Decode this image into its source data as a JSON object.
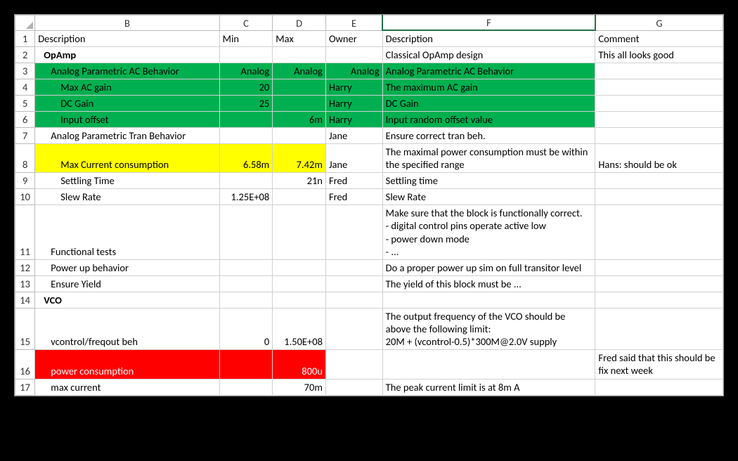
{
  "columns": {
    "b": "B",
    "c": "C",
    "d": "D",
    "e": "E",
    "f": "F",
    "g": "G"
  },
  "rownum": {
    "r1": "1",
    "r2": "2",
    "r3": "3",
    "r4": "4",
    "r5": "5",
    "r6": "6",
    "r7": "7",
    "r8": "8",
    "r9": "9",
    "r10": "10",
    "r11": "11",
    "r12": "12",
    "r13": "13",
    "r14": "14",
    "r15": "15",
    "r16": "16",
    "r17": "17"
  },
  "header": {
    "b": "Description",
    "c": "Min",
    "d": "Max",
    "e": "Owner",
    "f": "Description",
    "g": "Comment"
  },
  "r2": {
    "b": "OpAmp",
    "f": "Classical OpAmp design",
    "g": "This all looks good"
  },
  "r3": {
    "b": "Analog Parametric AC Behavior",
    "c": "Analog",
    "d": "Analog",
    "e": "Analog",
    "f": "Analog Parametric AC Behavior"
  },
  "r4": {
    "b": "Max AC gain",
    "c": "20",
    "e": "Harry",
    "f": "The maximum AC gain"
  },
  "r5": {
    "b": "DC Gain",
    "c": "25",
    "e": "Harry",
    "f": "DC Gain"
  },
  "r6": {
    "b": "Input offset",
    "c": "6m",
    "e": "Harry",
    "f": "Input random offset value"
  },
  "r7": {
    "b": "Analog Parametric Tran Behavior",
    "e": "Jane",
    "f": "Ensure correct tran beh."
  },
  "r8": {
    "b": "Max Current consumption",
    "c": "6.58m",
    "d": "7.42m",
    "e": "Jane",
    "f": "The maximal power consumption must be within the specified range",
    "g": "Hans: should be ok"
  },
  "r9": {
    "b": "Settling Time",
    "d": "21n",
    "e": "Fred",
    "f": "Settling time"
  },
  "r10": {
    "b": "Slew Rate",
    "c": "1.25E+08",
    "e": "Fred",
    "f": "Slew Rate"
  },
  "r11": {
    "b": "Functional tests",
    "f": "Make sure that the block is functionally correct.\n- digital control pins operate active low\n- power down mode\n- ..."
  },
  "r12": {
    "b": "Power up behavior",
    "f": "Do a proper power up sim on full transitor level"
  },
  "r13": {
    "b": "Ensure Yield",
    "f": "The yield of this block must be ..."
  },
  "r14": {
    "b": "VCO"
  },
  "r15": {
    "b": "vcontrol/freqout beh",
    "c": "0",
    "d": "1.50E+08",
    "f": "The output frequency of the VCO should be above the following limit:\n20M + (vcontrol-0.5)*300M@2.0V supply"
  },
  "r16": {
    "b": "power consumption",
    "d": "800u",
    "g": "Fred said that this should be fix next week"
  },
  "r17": {
    "b": "max current",
    "d": "70m",
    "f": "The peak current limit is at 8m A"
  }
}
